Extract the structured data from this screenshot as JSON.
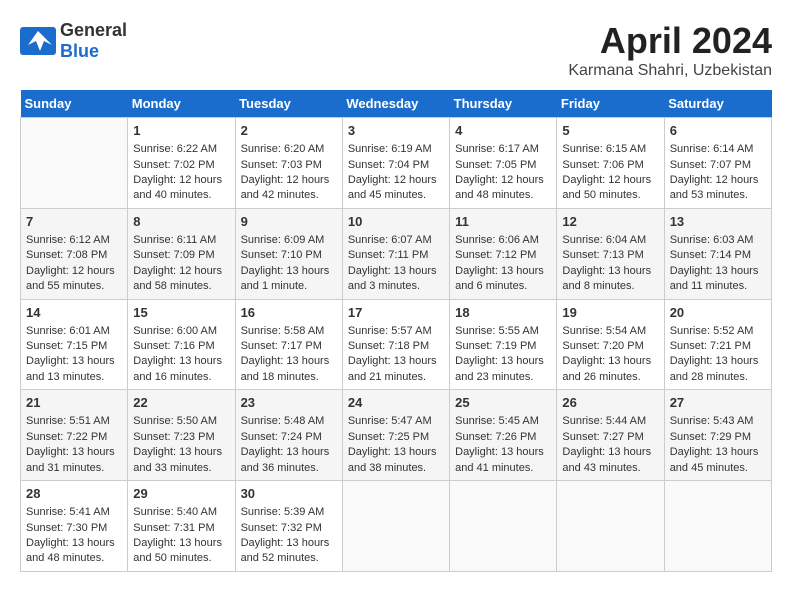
{
  "header": {
    "logo_line1": "General",
    "logo_line2": "Blue",
    "month": "April 2024",
    "location": "Karmana Shahri, Uzbekistan"
  },
  "days_of_week": [
    "Sunday",
    "Monday",
    "Tuesday",
    "Wednesday",
    "Thursday",
    "Friday",
    "Saturday"
  ],
  "weeks": [
    [
      {
        "day": "",
        "sunrise": "",
        "sunset": "",
        "daylight": ""
      },
      {
        "day": "1",
        "sunrise": "Sunrise: 6:22 AM",
        "sunset": "Sunset: 7:02 PM",
        "daylight": "Daylight: 12 hours and 40 minutes."
      },
      {
        "day": "2",
        "sunrise": "Sunrise: 6:20 AM",
        "sunset": "Sunset: 7:03 PM",
        "daylight": "Daylight: 12 hours and 42 minutes."
      },
      {
        "day": "3",
        "sunrise": "Sunrise: 6:19 AM",
        "sunset": "Sunset: 7:04 PM",
        "daylight": "Daylight: 12 hours and 45 minutes."
      },
      {
        "day": "4",
        "sunrise": "Sunrise: 6:17 AM",
        "sunset": "Sunset: 7:05 PM",
        "daylight": "Daylight: 12 hours and 48 minutes."
      },
      {
        "day": "5",
        "sunrise": "Sunrise: 6:15 AM",
        "sunset": "Sunset: 7:06 PM",
        "daylight": "Daylight: 12 hours and 50 minutes."
      },
      {
        "day": "6",
        "sunrise": "Sunrise: 6:14 AM",
        "sunset": "Sunset: 7:07 PM",
        "daylight": "Daylight: 12 hours and 53 minutes."
      }
    ],
    [
      {
        "day": "7",
        "sunrise": "Sunrise: 6:12 AM",
        "sunset": "Sunset: 7:08 PM",
        "daylight": "Daylight: 12 hours and 55 minutes."
      },
      {
        "day": "8",
        "sunrise": "Sunrise: 6:11 AM",
        "sunset": "Sunset: 7:09 PM",
        "daylight": "Daylight: 12 hours and 58 minutes."
      },
      {
        "day": "9",
        "sunrise": "Sunrise: 6:09 AM",
        "sunset": "Sunset: 7:10 PM",
        "daylight": "Daylight: 13 hours and 1 minute."
      },
      {
        "day": "10",
        "sunrise": "Sunrise: 6:07 AM",
        "sunset": "Sunset: 7:11 PM",
        "daylight": "Daylight: 13 hours and 3 minutes."
      },
      {
        "day": "11",
        "sunrise": "Sunrise: 6:06 AM",
        "sunset": "Sunset: 7:12 PM",
        "daylight": "Daylight: 13 hours and 6 minutes."
      },
      {
        "day": "12",
        "sunrise": "Sunrise: 6:04 AM",
        "sunset": "Sunset: 7:13 PM",
        "daylight": "Daylight: 13 hours and 8 minutes."
      },
      {
        "day": "13",
        "sunrise": "Sunrise: 6:03 AM",
        "sunset": "Sunset: 7:14 PM",
        "daylight": "Daylight: 13 hours and 11 minutes."
      }
    ],
    [
      {
        "day": "14",
        "sunrise": "Sunrise: 6:01 AM",
        "sunset": "Sunset: 7:15 PM",
        "daylight": "Daylight: 13 hours and 13 minutes."
      },
      {
        "day": "15",
        "sunrise": "Sunrise: 6:00 AM",
        "sunset": "Sunset: 7:16 PM",
        "daylight": "Daylight: 13 hours and 16 minutes."
      },
      {
        "day": "16",
        "sunrise": "Sunrise: 5:58 AM",
        "sunset": "Sunset: 7:17 PM",
        "daylight": "Daylight: 13 hours and 18 minutes."
      },
      {
        "day": "17",
        "sunrise": "Sunrise: 5:57 AM",
        "sunset": "Sunset: 7:18 PM",
        "daylight": "Daylight: 13 hours and 21 minutes."
      },
      {
        "day": "18",
        "sunrise": "Sunrise: 5:55 AM",
        "sunset": "Sunset: 7:19 PM",
        "daylight": "Daylight: 13 hours and 23 minutes."
      },
      {
        "day": "19",
        "sunrise": "Sunrise: 5:54 AM",
        "sunset": "Sunset: 7:20 PM",
        "daylight": "Daylight: 13 hours and 26 minutes."
      },
      {
        "day": "20",
        "sunrise": "Sunrise: 5:52 AM",
        "sunset": "Sunset: 7:21 PM",
        "daylight": "Daylight: 13 hours and 28 minutes."
      }
    ],
    [
      {
        "day": "21",
        "sunrise": "Sunrise: 5:51 AM",
        "sunset": "Sunset: 7:22 PM",
        "daylight": "Daylight: 13 hours and 31 minutes."
      },
      {
        "day": "22",
        "sunrise": "Sunrise: 5:50 AM",
        "sunset": "Sunset: 7:23 PM",
        "daylight": "Daylight: 13 hours and 33 minutes."
      },
      {
        "day": "23",
        "sunrise": "Sunrise: 5:48 AM",
        "sunset": "Sunset: 7:24 PM",
        "daylight": "Daylight: 13 hours and 36 minutes."
      },
      {
        "day": "24",
        "sunrise": "Sunrise: 5:47 AM",
        "sunset": "Sunset: 7:25 PM",
        "daylight": "Daylight: 13 hours and 38 minutes."
      },
      {
        "day": "25",
        "sunrise": "Sunrise: 5:45 AM",
        "sunset": "Sunset: 7:26 PM",
        "daylight": "Daylight: 13 hours and 41 minutes."
      },
      {
        "day": "26",
        "sunrise": "Sunrise: 5:44 AM",
        "sunset": "Sunset: 7:27 PM",
        "daylight": "Daylight: 13 hours and 43 minutes."
      },
      {
        "day": "27",
        "sunrise": "Sunrise: 5:43 AM",
        "sunset": "Sunset: 7:29 PM",
        "daylight": "Daylight: 13 hours and 45 minutes."
      }
    ],
    [
      {
        "day": "28",
        "sunrise": "Sunrise: 5:41 AM",
        "sunset": "Sunset: 7:30 PM",
        "daylight": "Daylight: 13 hours and 48 minutes."
      },
      {
        "day": "29",
        "sunrise": "Sunrise: 5:40 AM",
        "sunset": "Sunset: 7:31 PM",
        "daylight": "Daylight: 13 hours and 50 minutes."
      },
      {
        "day": "30",
        "sunrise": "Sunrise: 5:39 AM",
        "sunset": "Sunset: 7:32 PM",
        "daylight": "Daylight: 13 hours and 52 minutes."
      },
      {
        "day": "",
        "sunrise": "",
        "sunset": "",
        "daylight": ""
      },
      {
        "day": "",
        "sunrise": "",
        "sunset": "",
        "daylight": ""
      },
      {
        "day": "",
        "sunrise": "",
        "sunset": "",
        "daylight": ""
      },
      {
        "day": "",
        "sunrise": "",
        "sunset": "",
        "daylight": ""
      }
    ]
  ]
}
